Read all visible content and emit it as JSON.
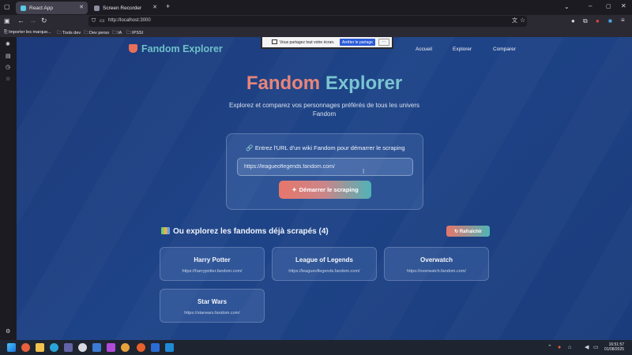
{
  "browser": {
    "tabs": [
      {
        "label": "React App",
        "active": true
      },
      {
        "label": "Screen Recorder",
        "active": false
      }
    ],
    "url": "http://localhost:3000",
    "bookmarks": [
      "Importer les marque...",
      "Tools dev",
      "Dev perso",
      "IA",
      "IPSSI"
    ]
  },
  "share_bar": {
    "message": "Vous partagez tout votre écran.",
    "stop_label": "Arrêter le partage",
    "more_label": "..."
  },
  "site": {
    "logo": "Fandom Explorer",
    "nav": [
      "Accueil",
      "Explorer",
      "Comparer"
    ]
  },
  "hero": {
    "title_part1": "Fandom",
    "title_part2": "Explorer",
    "subtitle": "Explorez et comparez vos personnages préférés de tous les univers Fandom"
  },
  "scrape_card": {
    "label": "🔗 Entrez l'URL d'un wiki Fandom pour démarrer le scraping",
    "input_value": "https://leagueoflegends.fandom.com/",
    "button_label": "Démarrer le scraping"
  },
  "fandoms_section": {
    "title": "Ou explorez les fandoms déjà scrapés (4)",
    "refresh_label": "Rafraîchir",
    "items": [
      {
        "name": "Harry Potter",
        "url": "https://harrypotter.fandom.com/"
      },
      {
        "name": "League of Legends",
        "url": "https://leagueoflegends.fandom.com/"
      },
      {
        "name": "Overwatch",
        "url": "https://overwatch.fandom.com/"
      },
      {
        "name": "Star Wars",
        "url": "https://starwars.fandom.com/"
      }
    ]
  },
  "taskbar": {
    "time": "16:51:57",
    "date": "01/08/2025"
  },
  "colors": {
    "accent_coral": "#e8766a",
    "accent_teal": "#4fb3b6",
    "page_bg": "#1e4488"
  }
}
